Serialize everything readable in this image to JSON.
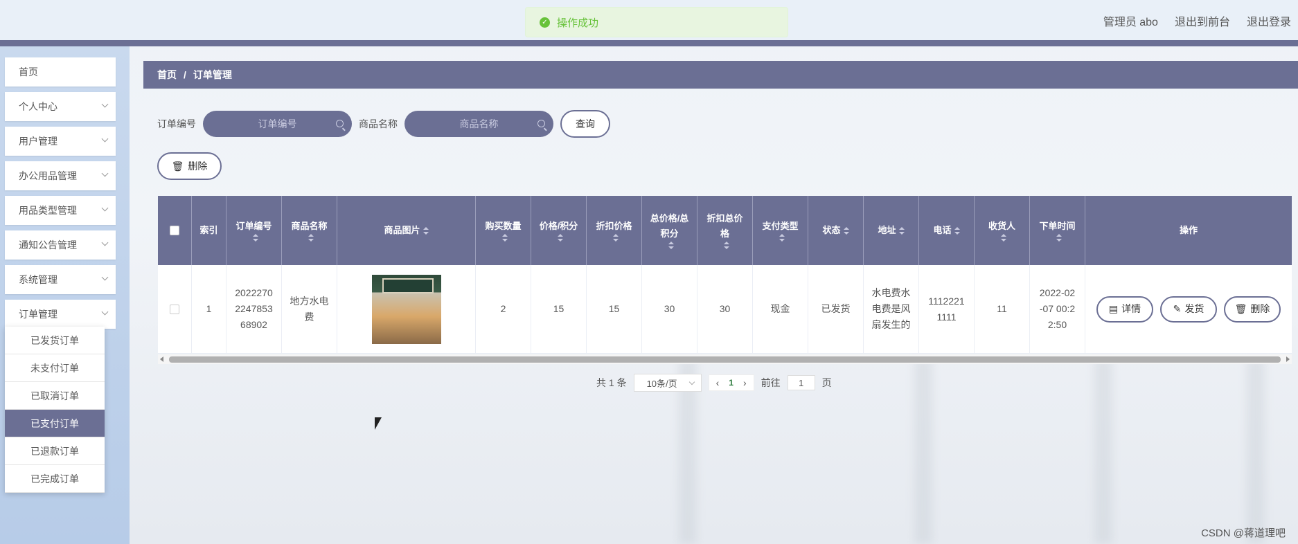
{
  "toast": {
    "text": "操作成功"
  },
  "header": {
    "admin": "管理员 abo",
    "to_front": "退出到前台",
    "logout": "退出登录"
  },
  "sidebar": {
    "items": [
      {
        "label": "首页"
      },
      {
        "label": "个人中心"
      },
      {
        "label": "用户管理"
      },
      {
        "label": "办公用品管理"
      },
      {
        "label": "用品类型管理"
      },
      {
        "label": "通知公告管理"
      },
      {
        "label": "系统管理"
      },
      {
        "label": "订单管理"
      }
    ],
    "submenu": [
      {
        "label": "已发货订单"
      },
      {
        "label": "未支付订单"
      },
      {
        "label": "已取消订单"
      },
      {
        "label": "已支付订单",
        "active": true
      },
      {
        "label": "已退款订单"
      },
      {
        "label": "已完成订单"
      }
    ]
  },
  "breadcrumb": {
    "home": "首页",
    "sep": "/",
    "current": "订单管理"
  },
  "search": {
    "order_label": "订单编号",
    "order_placeholder": "订单编号",
    "product_label": "商品名称",
    "product_placeholder": "商品名称",
    "query_button": "查询"
  },
  "toolbar": {
    "delete_button": "删除"
  },
  "table": {
    "headers": {
      "index": "索引",
      "order_no": "订单编号",
      "product_name": "商品名称",
      "product_image": "商品图片",
      "quantity": "购买数量",
      "price": "价格/积分",
      "discount_price": "折扣价格",
      "total": "总价格/总积分",
      "discount_total": "折扣总价格",
      "pay_type": "支付类型",
      "status": "状态",
      "address": "地址",
      "phone": "电话",
      "receiver": "收货人",
      "order_time": "下单时间",
      "actions": "操作"
    },
    "rows": [
      {
        "index": "1",
        "order_no": "2022270 2247853 68902",
        "product_name": "地方水电 费",
        "quantity": "2",
        "price": "15",
        "discount_price": "15",
        "total": "30",
        "discount_total": "30",
        "pay_type": "现金",
        "status": "已发货",
        "address": "水电费水 电费是风 扇发生的",
        "phone": "1112221 1111",
        "receiver": "11",
        "order_time": "2022-02 -07 00:2 2:50"
      }
    ],
    "action_labels": {
      "detail": "详情",
      "ship": "发货",
      "delete": "删除"
    }
  },
  "pagination": {
    "total": "共 1 条",
    "page_size": "10条/页",
    "current": "1",
    "goto_label": "前往",
    "goto_value": "1",
    "page_suffix": "页"
  },
  "watermark": "CSDN @蒋道理吧",
  "colors": {
    "primary": "#6b6f94",
    "success": "#67c23a"
  }
}
